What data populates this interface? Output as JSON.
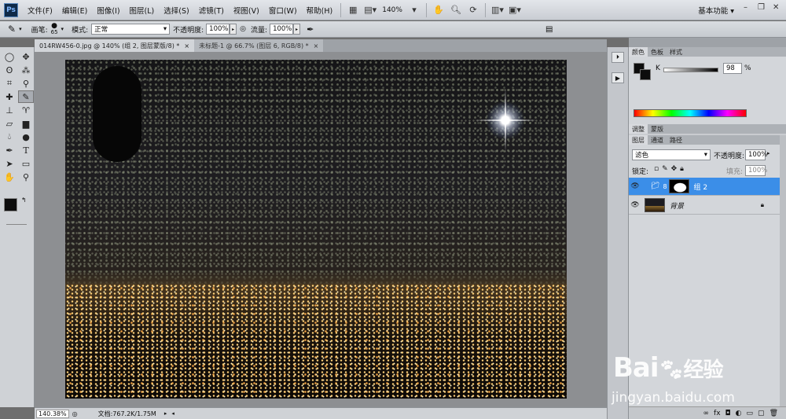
{
  "menubar": {
    "logo": "Ps",
    "items": [
      "文件(F)",
      "编辑(E)",
      "图像(I)",
      "图层(L)",
      "选择(S)",
      "滤镜(T)",
      "视图(V)",
      "窗口(W)",
      "帮助(H)"
    ],
    "zoom": "140%",
    "workspace": "基本功能"
  },
  "options": {
    "brush_label": "画笔:",
    "brush_size": "65",
    "mode_label": "模式:",
    "mode_value": "正常",
    "opacity_label": "不透明度:",
    "opacity_value": "100%",
    "flow_label": "流量:",
    "flow_value": "100%"
  },
  "tabs": [
    {
      "label": "014RW456-0.jpg @ 140% (组 2, 图层蒙版/8) *",
      "active": true
    },
    {
      "label": "未标题-1 @ 66.7% (图层 6, RGB/8) *",
      "active": false
    }
  ],
  "status": {
    "zoom": "140.38%",
    "doc": "文档:767.2K/1.75M"
  },
  "color_panel": {
    "tabs": [
      "颜色",
      "色板",
      "样式"
    ],
    "channel": "K",
    "value": "98",
    "unit": "%"
  },
  "adjust_tabs": [
    "调整",
    "蒙版"
  ],
  "layers_panel": {
    "tabs": [
      "图层",
      "通道",
      "路径"
    ],
    "blend_mode": "滤色",
    "opacity_label": "不透明度:",
    "opacity": "100%",
    "lock_label": "锁定:",
    "fill_label": "填充:",
    "fill": "100%",
    "layers": [
      {
        "name": "组 2",
        "selected": true
      },
      {
        "name": "背景",
        "selected": false
      }
    ]
  },
  "watermark": {
    "brand": "Bai",
    "brand2": "经验",
    "url": "jingyan.baidu.com"
  }
}
